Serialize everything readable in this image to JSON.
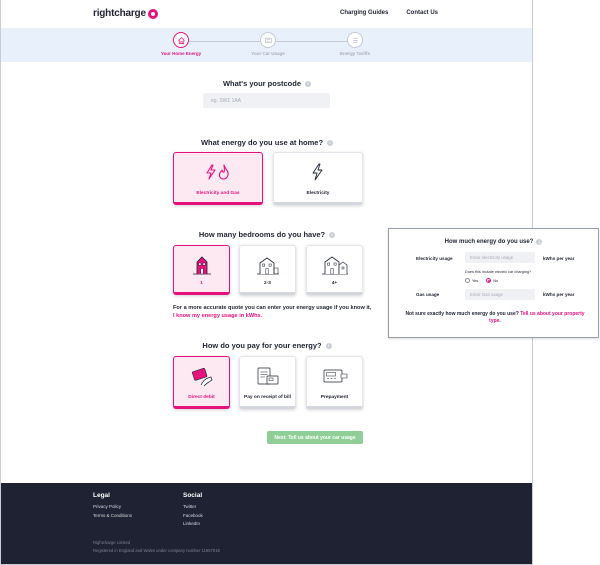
{
  "header": {
    "logo_text": "rightcharge",
    "nav": [
      "Charging Guides",
      "Contact Us"
    ]
  },
  "stepper": {
    "steps": [
      {
        "label": "Your Home Energy",
        "icon": "home-icon",
        "active": true
      },
      {
        "label": "Your Car Usage",
        "icon": "car-usage-icon",
        "active": false
      },
      {
        "label": "Energy Tariffs",
        "icon": "list-icon",
        "active": false
      }
    ]
  },
  "postcode": {
    "question": "What's your postcode",
    "placeholder": "eg. SW1 1AA"
  },
  "energy": {
    "question": "What energy do you use at home?",
    "options": [
      {
        "label": "Electricity and Gas",
        "selected": true
      },
      {
        "label": "Electricity",
        "selected": false
      }
    ]
  },
  "bedrooms": {
    "question": "How many bedrooms do you have?",
    "options": [
      {
        "label": "1",
        "selected": true
      },
      {
        "label": "2-3",
        "selected": false
      },
      {
        "label": "4+",
        "selected": false
      }
    ],
    "hint_text": "For a more accurate quote you can enter your energy usage if you know it,",
    "hint_link": "I know my energy usage in kWhs."
  },
  "payment": {
    "question": "How do you pay for your energy?",
    "options": [
      {
        "label": "Direct debit",
        "selected": true
      },
      {
        "label": "Pay on receipt of bill",
        "selected": false
      },
      {
        "label": "Prepayment",
        "selected": false
      }
    ]
  },
  "next_button": "Next: Tell us about your car usage",
  "footer": {
    "legal_heading": "Legal",
    "legal_links": [
      "Privacy Policy",
      "Terms & Conditions"
    ],
    "social_heading": "Social",
    "social_links": [
      "Twitter",
      "Facebook",
      "LinkedIn"
    ],
    "company": "Rightcharge Limited",
    "registration": "Registered in England and Wales under company number 11957018"
  },
  "usage_panel": {
    "title": "How much energy do you use?",
    "electricity_label": "Electricity usage",
    "electricity_placeholder": "Enter electricity usage",
    "unit": "kWhs per year",
    "ev_question": "Does this include electric car charging?",
    "radio_yes": "Yes",
    "radio_no": "No",
    "radio_selected": "No",
    "gas_label": "Gas usage",
    "gas_placeholder": "Enter Gas usage",
    "footer_text": "Not sure exactly how much energy do you use?",
    "footer_link": "Tell us about your property type."
  },
  "colors": {
    "accent": "#e5127d",
    "stepper_bg": "#e8f0fb",
    "footer_bg": "#1e2232",
    "next_button": "#8fcf97"
  }
}
